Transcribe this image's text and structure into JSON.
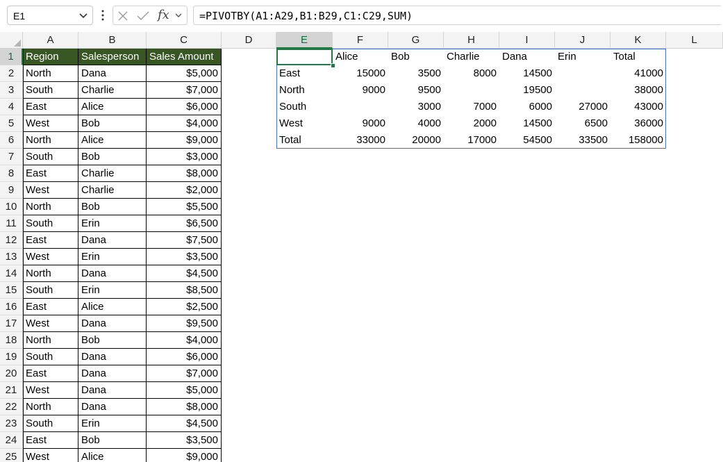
{
  "formula_bar": {
    "name_box": "E1",
    "formula": "=PIVOTBY(A1:A29,B1:B29,C1:C29,SUM)",
    "fx_label": "fx"
  },
  "sheet": {
    "active_column": "E",
    "active_row": "1",
    "columns": [
      {
        "label": "A"
      },
      {
        "label": "B"
      },
      {
        "label": "C"
      },
      {
        "label": "D"
      },
      {
        "label": "E"
      },
      {
        "label": "F"
      },
      {
        "label": "G"
      },
      {
        "label": "H"
      },
      {
        "label": "I"
      },
      {
        "label": "J"
      },
      {
        "label": "K"
      },
      {
        "label": "L"
      }
    ],
    "row_numbers": [
      "1",
      "2",
      "3",
      "4",
      "5",
      "6",
      "7",
      "8",
      "9",
      "10",
      "11",
      "12",
      "13",
      "14",
      "15",
      "16",
      "17",
      "18",
      "19",
      "20",
      "21",
      "22",
      "23",
      "24",
      "25"
    ],
    "table_header": [
      "Region",
      "Salesperson",
      "Sales Amount"
    ],
    "table_header_color": "#375623",
    "data_rows": [
      [
        "North",
        "Dana",
        "$5,000"
      ],
      [
        "South",
        "Charlie",
        "$7,000"
      ],
      [
        "East",
        "Alice",
        "$6,000"
      ],
      [
        "West",
        "Bob",
        "$4,000"
      ],
      [
        "North",
        "Alice",
        "$9,000"
      ],
      [
        "South",
        "Bob",
        "$3,000"
      ],
      [
        "East",
        "Charlie",
        "$8,000"
      ],
      [
        "West",
        "Charlie",
        "$2,000"
      ],
      [
        "North",
        "Bob",
        "$5,500"
      ],
      [
        "South",
        "Erin",
        "$6,500"
      ],
      [
        "East",
        "Dana",
        "$7,500"
      ],
      [
        "West",
        "Erin",
        "$3,500"
      ],
      [
        "North",
        "Dana",
        "$4,500"
      ],
      [
        "South",
        "Erin",
        "$8,500"
      ],
      [
        "East",
        "Alice",
        "$2,500"
      ],
      [
        "West",
        "Dana",
        "$9,500"
      ],
      [
        "North",
        "Bob",
        "$4,000"
      ],
      [
        "South",
        "Dana",
        "$6,000"
      ],
      [
        "East",
        "Dana",
        "$7,000"
      ],
      [
        "West",
        "Dana",
        "$5,000"
      ],
      [
        "North",
        "Dana",
        "$8,000"
      ],
      [
        "South",
        "Erin",
        "$4,500"
      ],
      [
        "East",
        "Bob",
        "$3,500"
      ],
      [
        "West",
        "Alice",
        "$9,000"
      ]
    ],
    "pivot": {
      "header": [
        "",
        "Alice",
        "Bob",
        "Charlie",
        "Dana",
        "Erin",
        "Total"
      ],
      "rows": [
        [
          "East",
          "15000",
          "3500",
          "8000",
          "14500",
          "",
          "41000"
        ],
        [
          "North",
          "9000",
          "9500",
          "",
          "19500",
          "",
          "38000"
        ],
        [
          "South",
          "",
          "3000",
          "7000",
          "6000",
          "27000",
          "43000"
        ],
        [
          "West",
          "9000",
          "4000",
          "2000",
          "14500",
          "6500",
          "36000"
        ],
        [
          "Total",
          "33000",
          "20000",
          "17000",
          "54500",
          "33500",
          "158000"
        ]
      ]
    }
  }
}
